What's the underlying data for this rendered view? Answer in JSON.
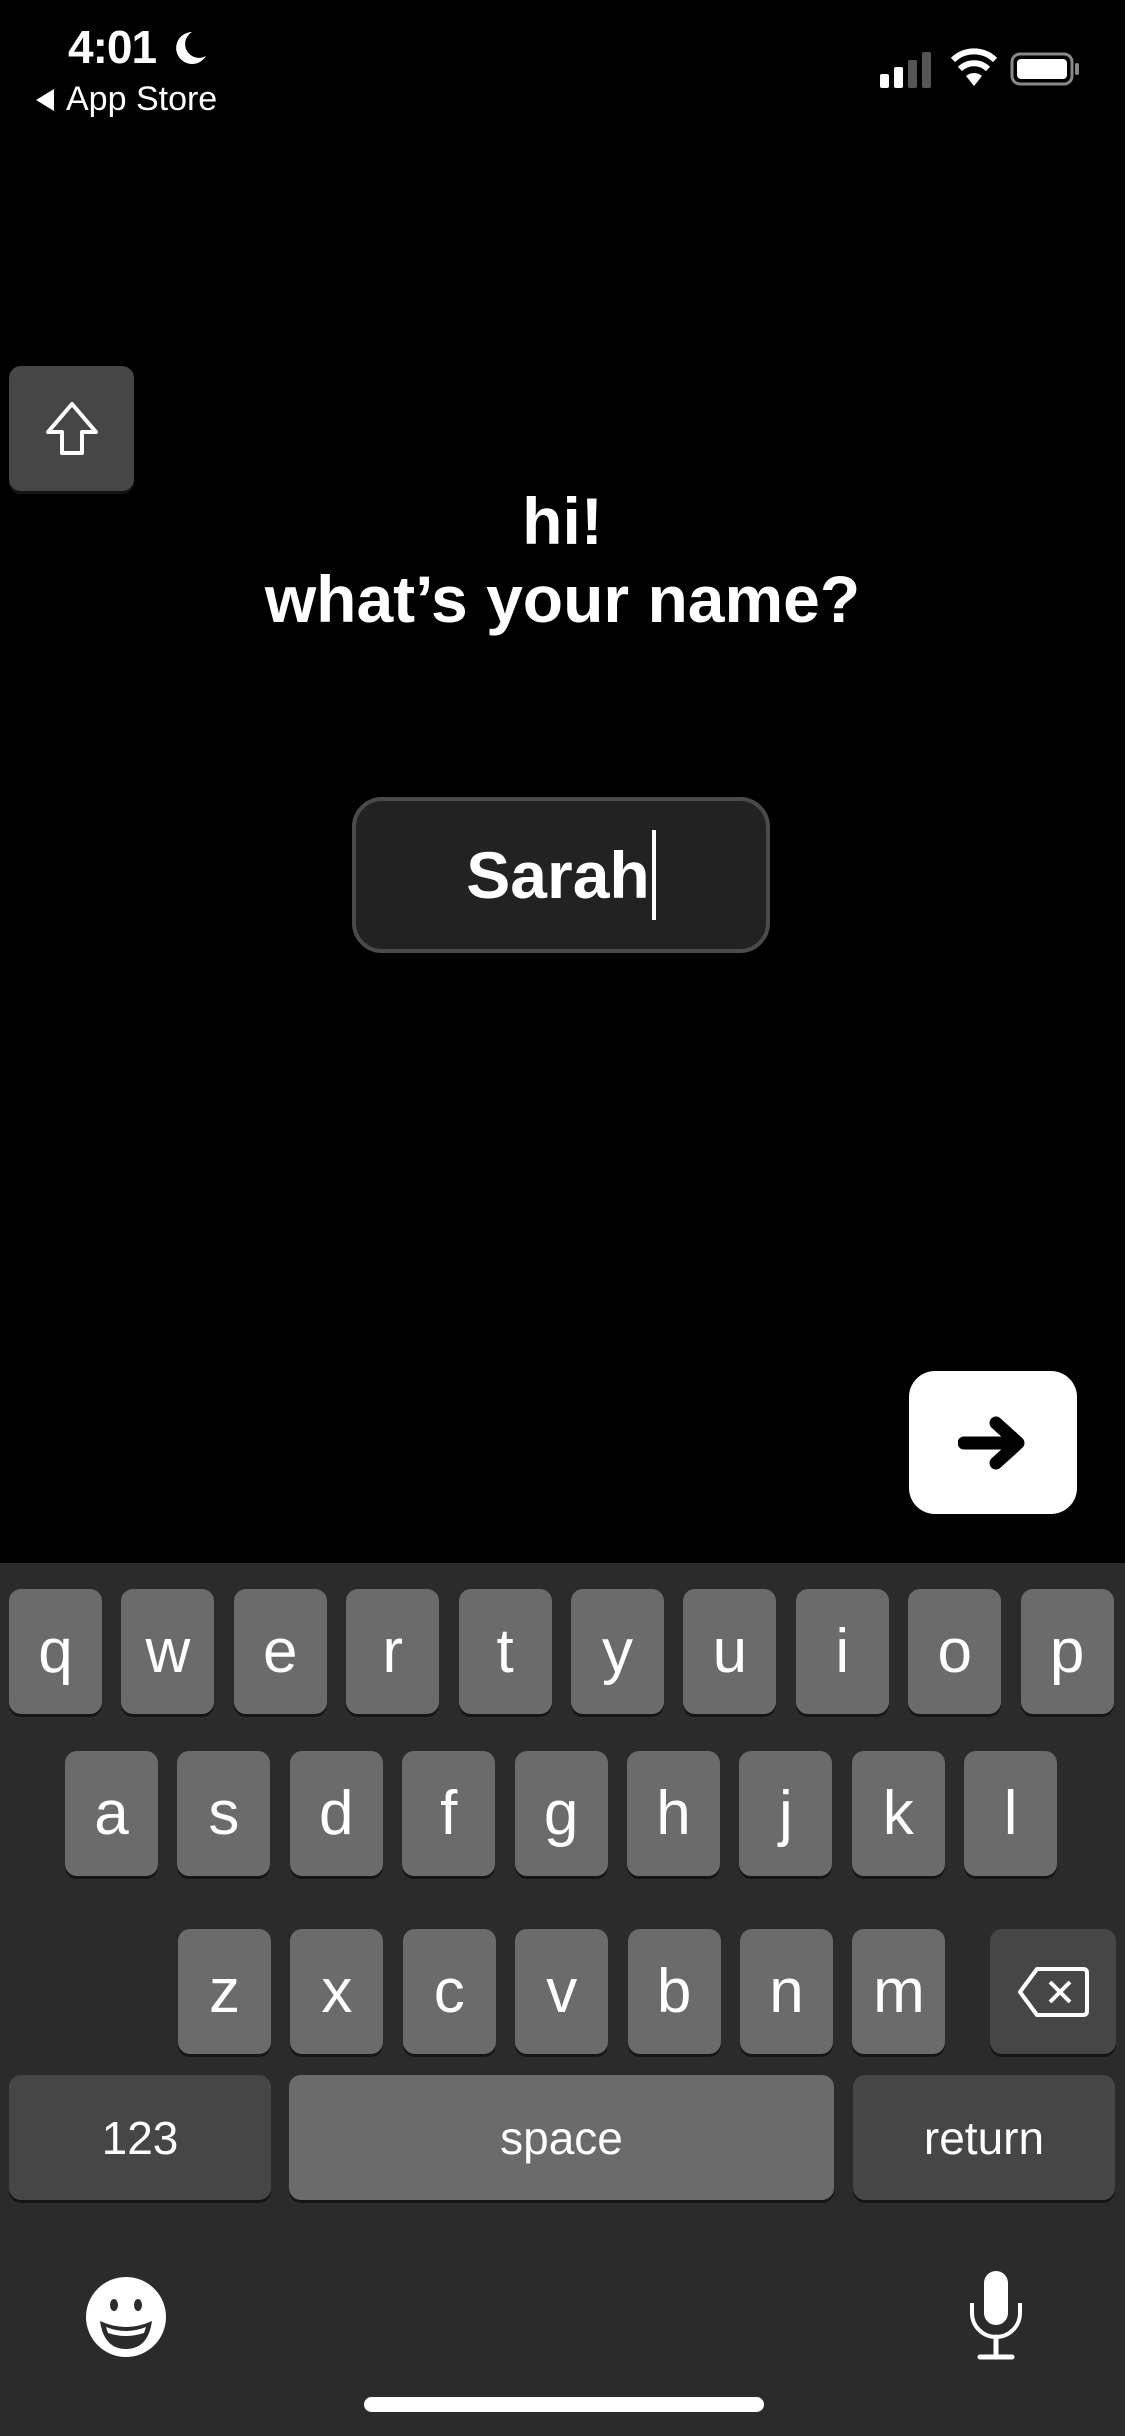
{
  "status_bar": {
    "time": "4:01",
    "back_label": "App Store",
    "icons": [
      "moon-icon",
      "cellular-signal-icon",
      "wifi-icon",
      "battery-icon"
    ]
  },
  "main": {
    "title_line1": "hi!",
    "title_line2": "what’s your name?",
    "name_input": {
      "value": "Sarah"
    },
    "next_button": {
      "icon": "arrow-right-icon"
    }
  },
  "keyboard": {
    "row1": [
      "q",
      "w",
      "e",
      "r",
      "t",
      "y",
      "u",
      "i",
      "o",
      "p"
    ],
    "row2": [
      "a",
      "s",
      "d",
      "f",
      "g",
      "h",
      "j",
      "k",
      "l"
    ],
    "row3": [
      "z",
      "x",
      "c",
      "v",
      "b",
      "n",
      "m"
    ],
    "numbers_label": "123",
    "space_label": "space",
    "return_label": "return",
    "colors": {
      "background": "#2b2b2b",
      "key": "#6b6b6b",
      "special_key": "#464646"
    }
  }
}
